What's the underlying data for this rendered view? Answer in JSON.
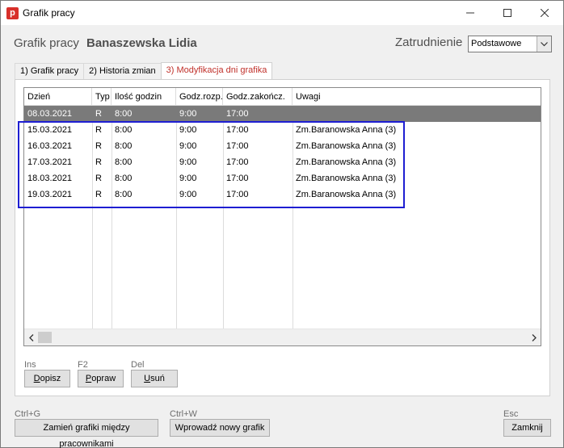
{
  "window": {
    "title": "Grafik pracy",
    "app_icon_letter": "p"
  },
  "header": {
    "label": "Grafik pracy",
    "name": "Banaszewska Lidia",
    "employment_label": "Zatrudnienie",
    "employment_value": "Podstawowe"
  },
  "tabs": [
    {
      "label": "1) Grafik pracy",
      "active": false
    },
    {
      "label": "2) Historia zmian",
      "active": false
    },
    {
      "label": "3) Modyfikacja dni grafika",
      "active": true
    }
  ],
  "table": {
    "columns": [
      "Dzień",
      "Typ",
      "Ilość godzin",
      "Godz.rozp.",
      "Godz.zakończ.",
      "Uwagi"
    ],
    "rows": [
      {
        "day": "08.03.2021",
        "type": "R",
        "hours": "8:00",
        "start": "9:00",
        "end": "17:00",
        "notes": "",
        "selected": true
      },
      {
        "day": "15.03.2021",
        "type": "R",
        "hours": "8:00",
        "start": "9:00",
        "end": "17:00",
        "notes": "Zm.Baranowska Anna (3)",
        "selected": false
      },
      {
        "day": "16.03.2021",
        "type": "R",
        "hours": "8:00",
        "start": "9:00",
        "end": "17:00",
        "notes": "Zm.Baranowska Anna (3)",
        "selected": false
      },
      {
        "day": "17.03.2021",
        "type": "R",
        "hours": "8:00",
        "start": "9:00",
        "end": "17:00",
        "notes": "Zm.Baranowska Anna (3)",
        "selected": false
      },
      {
        "day": "18.03.2021",
        "type": "R",
        "hours": "8:00",
        "start": "9:00",
        "end": "17:00",
        "notes": "Zm.Baranowska Anna (3)",
        "selected": false
      },
      {
        "day": "19.03.2021",
        "type": "R",
        "hours": "8:00",
        "start": "9:00",
        "end": "17:00",
        "notes": "Zm.Baranowska Anna (3)",
        "selected": false
      }
    ]
  },
  "panel_buttons": [
    {
      "hotkey": "Ins",
      "label": "Dopisz",
      "underline": "D",
      "rest": "opisz"
    },
    {
      "hotkey": "F2",
      "label": "Popraw",
      "underline": "P",
      "rest": "opraw"
    },
    {
      "hotkey": "Del",
      "label": "Usuń",
      "underline": "U",
      "rest": "suń"
    }
  ],
  "footer": {
    "swap": {
      "hotkey": "Ctrl+G",
      "label": "Zamień grafiki między pracownikami"
    },
    "new": {
      "hotkey": "Ctrl+W",
      "label": "Wprowadź nowy grafik"
    },
    "close": {
      "hotkey": "Esc",
      "label": "Zamknij"
    }
  },
  "colors": {
    "accent_tab": "#c0302a",
    "selected_row": "#7a7a7a",
    "highlight_box": "#1e1ed2"
  }
}
